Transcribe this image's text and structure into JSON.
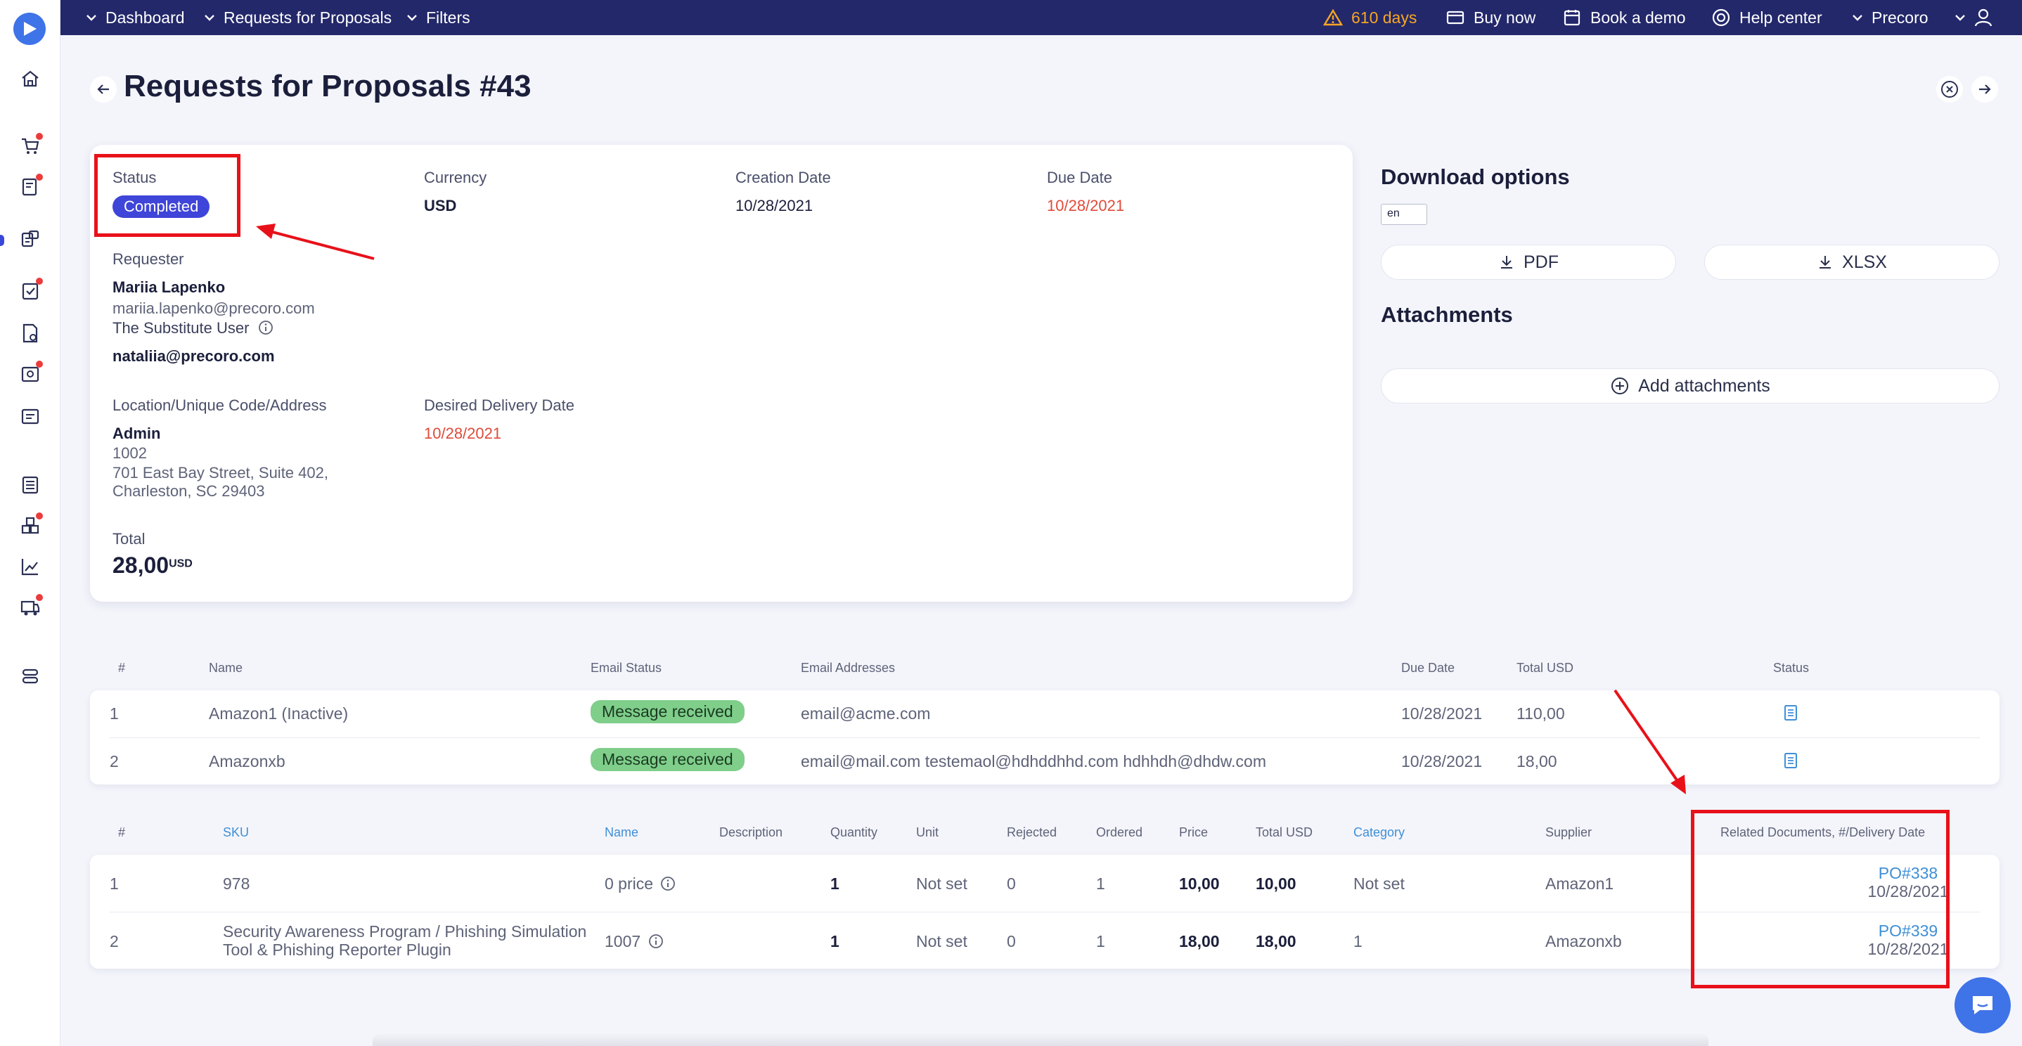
{
  "topbar": {
    "dashboard": "Dashboard",
    "rfp": "Requests for Proposals",
    "filters": "Filters",
    "trial": "610 days",
    "buy": "Buy now",
    "demo": "Book a demo",
    "help": "Help center",
    "company": "Precoro"
  },
  "page": {
    "title": "Requests for Proposals #43"
  },
  "details": {
    "status_label": "Status",
    "status_value": "Completed",
    "currency_label": "Currency",
    "currency_value": "USD",
    "creation_label": "Creation Date",
    "creation_value": "10/28/2021",
    "due_label": "Due Date",
    "due_value": "10/28/2021",
    "requester_label": "Requester",
    "requester_name": "Mariia Lapenko",
    "requester_email": "mariia.lapenko@precoro.com",
    "substitute_label": "The Substitute User",
    "substitute_email": "nataliia@precoro.com",
    "location_label": "Location/Unique Code/Address",
    "location_name": "Admin",
    "location_code": "1002",
    "location_addr1": "701 East Bay Street, Suite 402,",
    "location_addr2": "Charleston, SC 29403",
    "delivery_label": "Desired Delivery Date",
    "delivery_value": "10/28/2021",
    "total_label": "Total",
    "total_value": "28,00",
    "total_currency": "USD"
  },
  "right_panel": {
    "download_title": "Download options",
    "lang": "en",
    "pdf": "PDF",
    "xlsx": "XLSX",
    "attachments_title": "Attachments",
    "add_attachments": "Add attachments"
  },
  "suppliers_table": {
    "headers": [
      "#",
      "Name",
      "Email Status",
      "Email Addresses",
      "Due Date",
      "Total USD",
      "Status"
    ],
    "rows": [
      {
        "num": "1",
        "name": "Amazon1 (Inactive)",
        "email_status": "Message received",
        "emails": "email@acme.com",
        "due": "10/28/2021",
        "total": "110,00"
      },
      {
        "num": "2",
        "name": "Amazonxb",
        "email_status": "Message received",
        "emails": "email@mail.com testemaol@hdhddhhd.com hdhhdh@dhdw.com",
        "due": "10/28/2021",
        "total": "18,00"
      }
    ]
  },
  "items_table": {
    "headers": [
      "#",
      "SKU",
      "Name",
      "Description",
      "Quantity",
      "Unit",
      "Rejected",
      "Ordered",
      "Price",
      "Total USD",
      "Category",
      "Supplier",
      "Related Documents, #/Delivery Date"
    ],
    "rows": [
      {
        "num": "1",
        "sku": "978",
        "name": "0 price",
        "qty": "1",
        "unit": "Not set",
        "rejected": "0",
        "ordered": "1",
        "price": "10,00",
        "total": "10,00",
        "category": "Not set",
        "supplier": "Amazon1",
        "doc": "PO#338",
        "doc_date": "10/28/2021"
      },
      {
        "num": "2",
        "sku": "Security Awareness Program / Phishing Simulation",
        "sku2": "Tool & Phishing Reporter Plugin",
        "name": "1007",
        "qty": "1",
        "unit": "Not set",
        "rejected": "0",
        "ordered": "1",
        "price": "18,00",
        "total": "18,00",
        "category": "1",
        "supplier": "Amazonxb",
        "doc": "PO#339",
        "doc_date": "10/28/2021"
      }
    ]
  },
  "colors": {
    "topbar": "#23286b",
    "accent_blue": "#3f45d8",
    "link": "#3f8fd6",
    "green_badge": "#7fce8a",
    "date_red": "#e04a3a",
    "annotation_red": "#e8111a",
    "warning": "#f5a623"
  }
}
